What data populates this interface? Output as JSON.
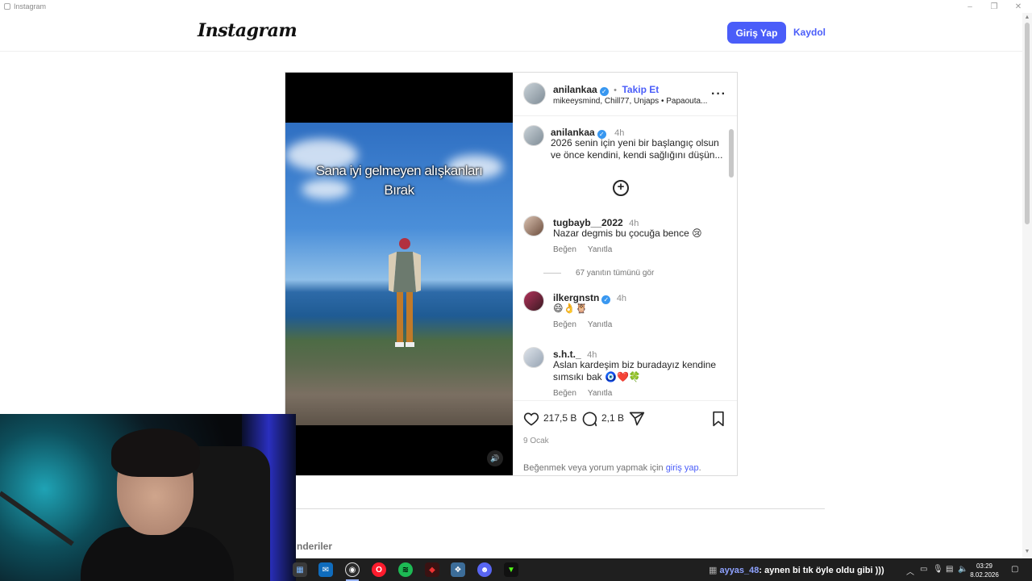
{
  "window": {
    "title": "Instagram",
    "controls": [
      "–",
      "❐",
      "✕"
    ]
  },
  "header": {
    "logo": "Instagram",
    "login_label": "Giriş Yap",
    "signup_label": "Kaydol"
  },
  "post": {
    "caption_overlay": [
      "Sana iyi gelmeyen alışkanları",
      "Bırak"
    ],
    "author": {
      "username": "anilankaa",
      "verified": true,
      "follow_label": "Takip Et",
      "separator": "•"
    },
    "subtitle": "mikeeysmind, Chill77, Unjaps • Papaouta...",
    "caption": {
      "username": "anilankaa",
      "time": "4h",
      "text_line1": "2026 senin için yeni bir başlangıç olsun",
      "text_line2": "ve önce kendini, kendi sağlığını düşün..."
    },
    "comments": [
      {
        "username": "tugbayb__2022",
        "time": "4h",
        "text": "Nazar degmis bu çocuğa bence 😢",
        "like_label": "Beğen",
        "reply_label": "Yanıtla"
      },
      {
        "username": "ilkergnstn",
        "verified": true,
        "time": "4h",
        "text": "😄👌🦉",
        "like_label": "Beğen",
        "reply_label": "Yanıtla"
      },
      {
        "username": "s.h.t._",
        "time": "4h",
        "text_line1": "Aslan kardeşim biz buradayız kendine",
        "text_line2": "sımsıkı bak 🧿❤️🍀",
        "like_label": "Beğen",
        "reply_label": "Yanıtla"
      }
    ],
    "view_replies": "67 yanıtın tümünü gör",
    "likes": "217,5 B",
    "comment_count": "2,1 B",
    "date": "9 Ocak",
    "login_prompt_prefix": "Beğenmek veya yorum yapmak için ",
    "login_prompt_link": "giriş yap",
    "login_prompt_suffix": "."
  },
  "more_posts_label": "nderiler",
  "taskbar": {
    "chat_user": "ayyas_48",
    "chat_message": ": aynen bi tık öyle oldu gibi )))",
    "time": "03:29",
    "date": "8.02.2026",
    "apps": [
      "windows-icon",
      "mail-icon",
      "obs-icon",
      "opera-icon",
      "spotify-icon",
      "capcut-icon",
      "dev-icon",
      "discord-icon",
      "kick-icon"
    ]
  },
  "colors": {
    "accent": "#4a5df9",
    "verified": "#3897f0",
    "taskbar": "#1f1f1f",
    "spotify": "#1db954",
    "kick": "#53fc18",
    "discord": "#5865f2",
    "opera": "#ff1b2d"
  }
}
